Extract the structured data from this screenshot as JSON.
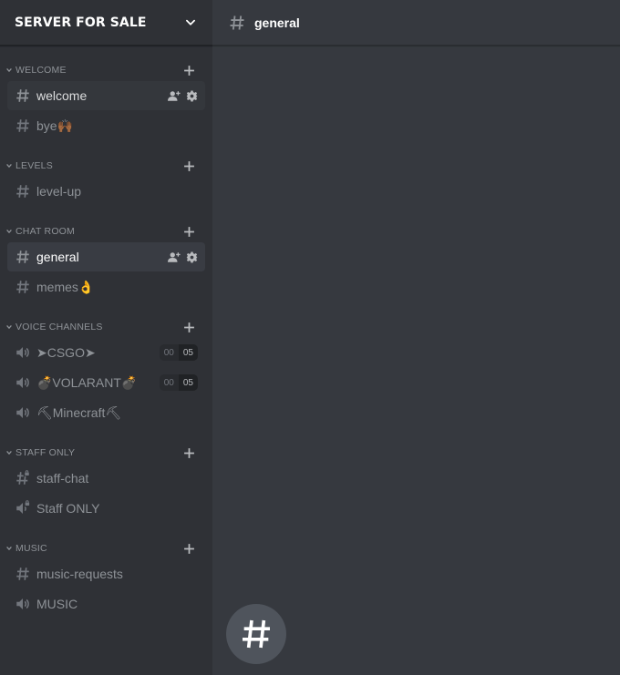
{
  "server": {
    "name": "SERVER FOR SALE"
  },
  "categories": [
    {
      "name": "WELCOME",
      "channels": [
        {
          "name": "welcome",
          "type": "text",
          "selected": false,
          "hovered": true
        },
        {
          "name": "bye🙌🏾",
          "type": "text"
        }
      ]
    },
    {
      "name": "LEVELS",
      "channels": [
        {
          "name": "level-up",
          "type": "text"
        }
      ]
    },
    {
      "name": "CHAT ROOM",
      "channels": [
        {
          "name": "general",
          "type": "text",
          "selected": true
        },
        {
          "name": "memes👌",
          "type": "text"
        }
      ]
    },
    {
      "name": "VOICE CHANNELS",
      "channels": [
        {
          "name": "➤CSGO➤",
          "type": "voice",
          "current": "00",
          "limit": "05"
        },
        {
          "name": "💣VOLARANT💣",
          "type": "voice",
          "current": "00",
          "limit": "05"
        },
        {
          "name": "⛏Minecraft⛏",
          "type": "voice"
        }
      ]
    },
    {
      "name": "STAFF ONLY",
      "channels": [
        {
          "name": "staff-chat",
          "type": "text-locked"
        },
        {
          "name": "Staff ONLY",
          "type": "voice-locked"
        }
      ]
    },
    {
      "name": "MUSIC",
      "channels": [
        {
          "name": "music-requests",
          "type": "text"
        },
        {
          "name": "MUSIC",
          "type": "voice"
        }
      ]
    }
  ],
  "main": {
    "channel_title": "general"
  },
  "colors": {
    "sidebar": "#2f3136",
    "main": "#36393f",
    "selected": "#393c43",
    "muted": "#8e9297"
  }
}
